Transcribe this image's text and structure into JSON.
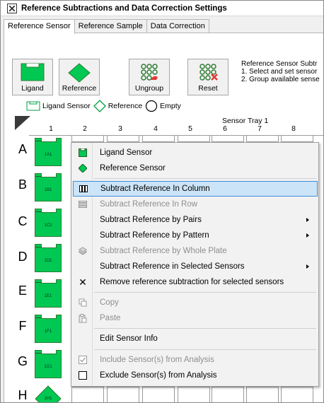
{
  "window": {
    "title": "Reference Subtractions and Data Correction Settings"
  },
  "tabs": [
    {
      "label": "Reference Sensor"
    },
    {
      "label": "Reference Sample"
    },
    {
      "label": "Data Correction"
    }
  ],
  "toolbar": {
    "ligand_label": "Ligand",
    "reference_label": "Reference",
    "ungroup_label": "Ungroup",
    "reset_label": "Reset"
  },
  "instructions": {
    "line1": "Reference Sensor Subtr",
    "line2": "1. Select and set sensor",
    "line3": "2. Group available sense"
  },
  "legend": {
    "ligand_sensor": "Ligand Sensor",
    "reference": "Reference",
    "empty": "Empty"
  },
  "tray": {
    "title": "Sensor Tray 1",
    "columns": [
      "1",
      "2",
      "3",
      "4",
      "5",
      "6",
      "7",
      "8"
    ],
    "rows": [
      "A",
      "B",
      "C",
      "D",
      "E",
      "F",
      "G",
      "H"
    ],
    "sensors": [
      "1A1",
      "1B1",
      "1C1",
      "1D1",
      "1E1",
      "1F1",
      "1G1",
      "1H1"
    ]
  },
  "menu": {
    "ligand_sensor": "Ligand Sensor",
    "reference_sensor": "Reference Sensor",
    "subtract_column": "Subtract Reference In Column",
    "subtract_row": "Subtract Reference In Row",
    "subtract_pairs": "Subtract Reference by Pairs",
    "subtract_pattern": "Subtract Reference by Pattern",
    "subtract_whole_plate": "Subtract Reference by Whole Plate",
    "subtract_selected": "Subtract Reference in Selected Sensors",
    "remove_subtraction": "Remove reference subtraction for selected sensors",
    "copy": "Copy",
    "paste": "Paste",
    "edit_sensor_info": "Edit Sensor Info",
    "include_sensors": "Include Sensor(s) from Analysis",
    "exclude_sensors": "Exclude Sensor(s) from Analysis"
  },
  "colors": {
    "ligand_green": "#00c853",
    "menu_highlight": "#cce4f7",
    "menu_highlight_border": "#3d8ed8",
    "reset_red": "#e53935"
  }
}
